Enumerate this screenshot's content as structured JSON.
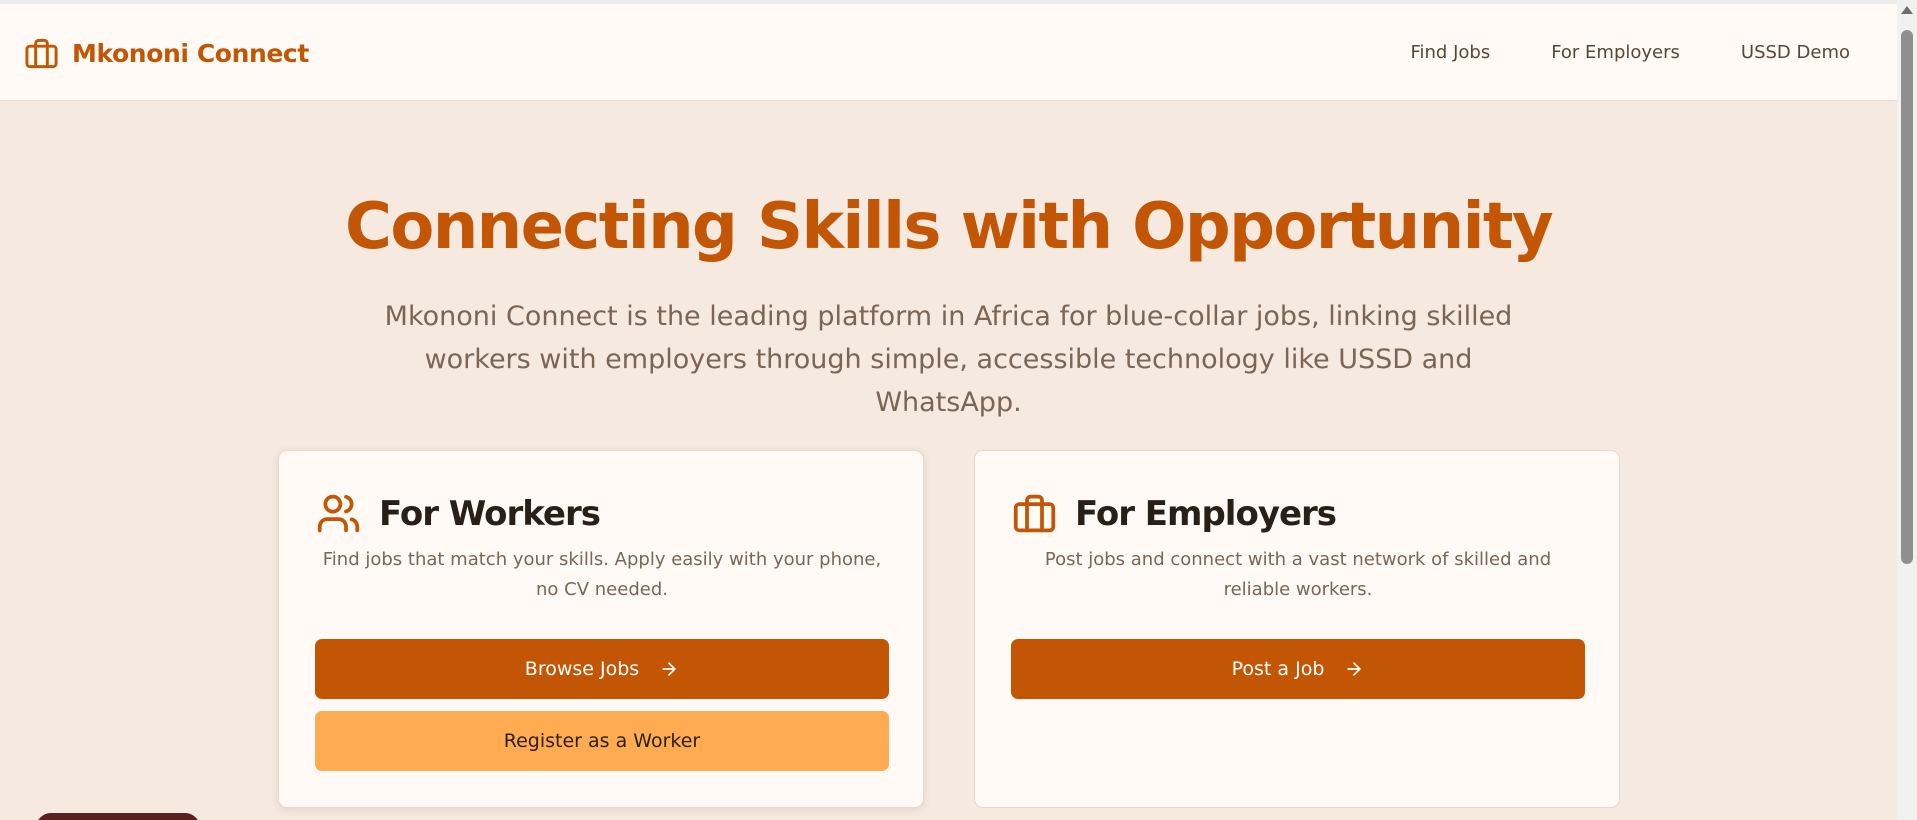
{
  "header": {
    "brand_name": "Mkononi Connect",
    "brand_icon": "briefcase-icon",
    "nav": [
      "Find Jobs",
      "For Employers",
      "USSD Demo"
    ]
  },
  "hero": {
    "title": "Connecting Skills with Opportunity",
    "subtitle_line1": "Mkononi Connect is the leading platform in Africa for blue-collar jobs, linking skilled",
    "subtitle_line2": "workers with employers through simple, accessible technology like USSD and WhatsApp."
  },
  "workers_card": {
    "icon": "users-icon",
    "title": "For Workers",
    "description_line1": "Find jobs that match your skills. Apply easily with your phone,",
    "description_line2": "no CV needed.",
    "primary_button": "Browse Jobs",
    "secondary_button": "Register as a Worker"
  },
  "employers_card": {
    "icon": "briefcase-icon",
    "title": "For Employers",
    "description_line1": "Post jobs and connect with a vast network of skilled and",
    "description_line2": "reliable workers.",
    "primary_button": "Post a Job"
  },
  "colors": {
    "accent": "#c25605",
    "accent_light": "#ffab52",
    "background": "#f5e9e0",
    "surface": "#fffaf6",
    "text_dark": "#2a1f17",
    "text_muted": "#7b6555"
  }
}
